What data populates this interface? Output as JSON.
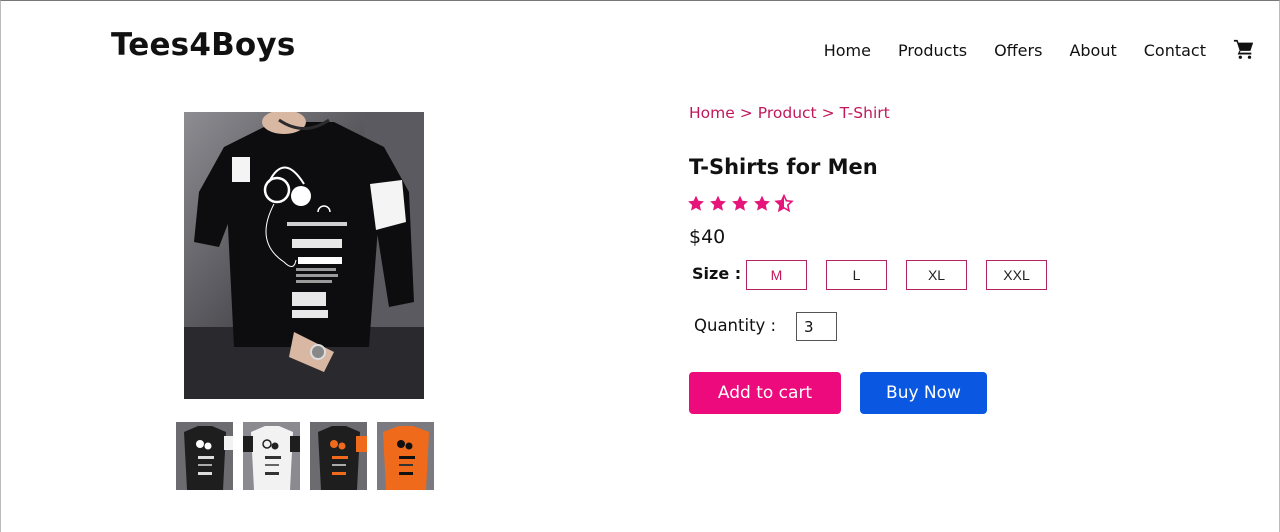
{
  "brand": {
    "name": "Tees4Boys"
  },
  "nav": {
    "items": [
      "Home",
      "Products",
      "Offers",
      "About",
      "Contact"
    ],
    "cart_icon": "shopping-cart-icon"
  },
  "breadcrumb": {
    "items": [
      "Home",
      "Product",
      "T-Shirt"
    ],
    "separator": ">"
  },
  "product": {
    "title": "T-Shirts for Men",
    "rating": 4.5,
    "rating_max": 5,
    "price": "$40",
    "size_label": "Size :",
    "sizes": [
      "M",
      "L",
      "XL",
      "XXL"
    ],
    "selected_size": "M",
    "quantity_label": "Quantity :",
    "quantity": "3",
    "add_to_cart": "Add to cart",
    "buy_now": "Buy Now",
    "thumbnail_colors": [
      "#1e1e1e",
      "#f2f2f2",
      "#1e1e1e",
      "#f06a1c"
    ]
  },
  "colors": {
    "accent_pink": "#ec0a7c",
    "breadcrumb": "#c2185b",
    "buy_blue": "#0a58e2"
  }
}
